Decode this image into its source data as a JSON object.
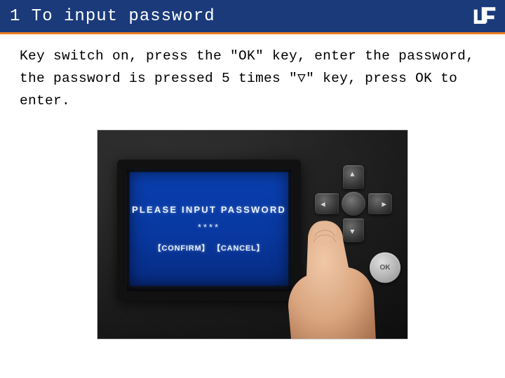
{
  "header": {
    "title": "1 To input password"
  },
  "instructions": "Key switch on, press the \"OK\" key, enter the password, the password is pressed 5 times \"▽\" key, press OK to enter.",
  "device_screen": {
    "line1": "PLEASE INPUT PASSWORD",
    "dots": "****",
    "confirm": "【CONFIRM】",
    "cancel": "【CANCEL】"
  },
  "buttons": {
    "ok": "OK"
  }
}
